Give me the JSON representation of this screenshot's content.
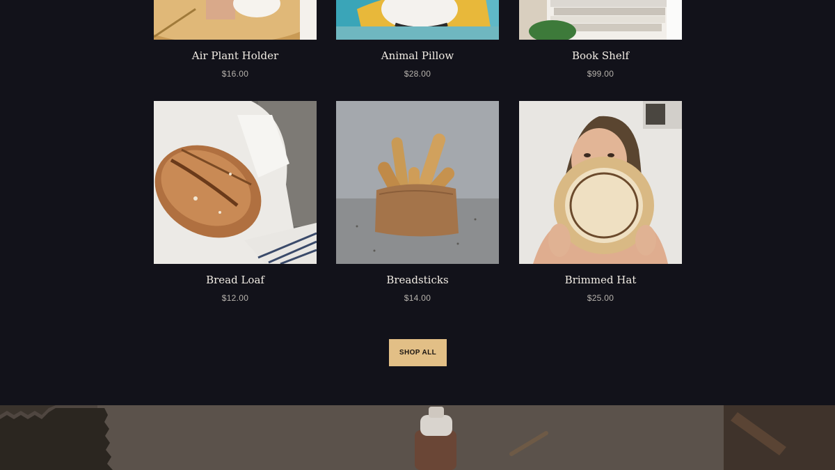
{
  "products": [
    {
      "name": "Air Plant Holder",
      "price": "$16.00",
      "icon": "air-plant-holder-image"
    },
    {
      "name": "Animal Pillow",
      "price": "$28.00",
      "icon": "animal-pillow-image"
    },
    {
      "name": "Book Shelf",
      "price": "$99.00",
      "icon": "book-shelf-image"
    },
    {
      "name": "Bread Loaf",
      "price": "$12.00",
      "icon": "bread-loaf-image"
    },
    {
      "name": "Breadsticks",
      "price": "$14.00",
      "icon": "breadsticks-image"
    },
    {
      "name": "Brimmed Hat",
      "price": "$25.00",
      "icon": "brimmed-hat-image"
    }
  ],
  "shop_all_label": "SHOP ALL",
  "colors": {
    "background": "#12121a",
    "accent": "#e2bf86",
    "name_text": "#f1ece4",
    "price_text": "#b7b3ad"
  }
}
